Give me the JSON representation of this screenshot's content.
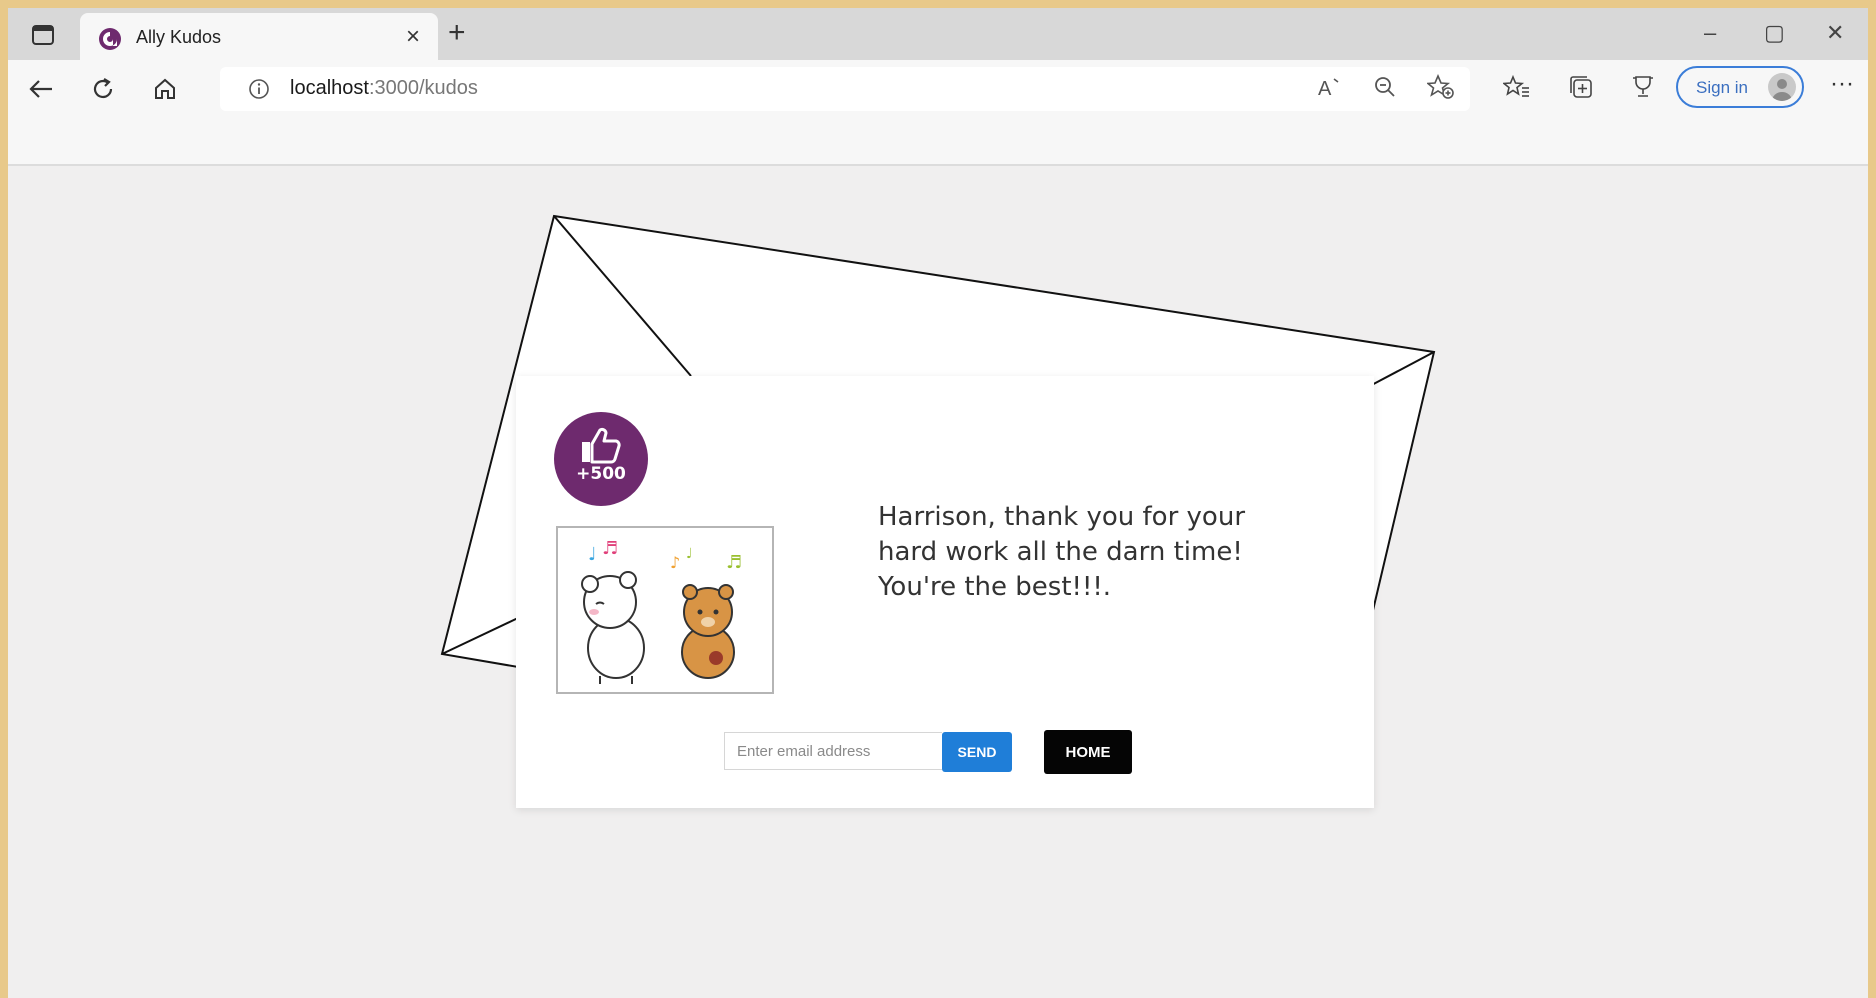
{
  "browser": {
    "tab_title": "Ally Kudos",
    "tab_close_label": "×",
    "new_tab_label": "+",
    "window_controls": {
      "minimize": "–",
      "maximize": "▢",
      "close": "✕"
    },
    "url_host": "localhost",
    "url_path": ":3000/kudos",
    "signin_label": "Sign in",
    "menu_label": "···",
    "icons": [
      "tab-actions-icon",
      "back-icon",
      "refresh-icon",
      "home-icon",
      "info-icon",
      "read-aloud-icon",
      "zoom-out-icon",
      "add-favorite-icon",
      "favorites-icon",
      "collections-icon",
      "browser-essentials-icon",
      "profile-avatar-icon"
    ]
  },
  "kudos": {
    "badge_text": "+500",
    "badge_color": "#6e2a6e",
    "message_lines": [
      "Harrison, thank you for your",
      "hard work all the darn time!",
      "You're the best!!!."
    ],
    "email_placeholder": "Enter email address",
    "email_value": "",
    "send_label": "SEND",
    "home_label": "HOME",
    "send_color": "#1f7ed8"
  }
}
